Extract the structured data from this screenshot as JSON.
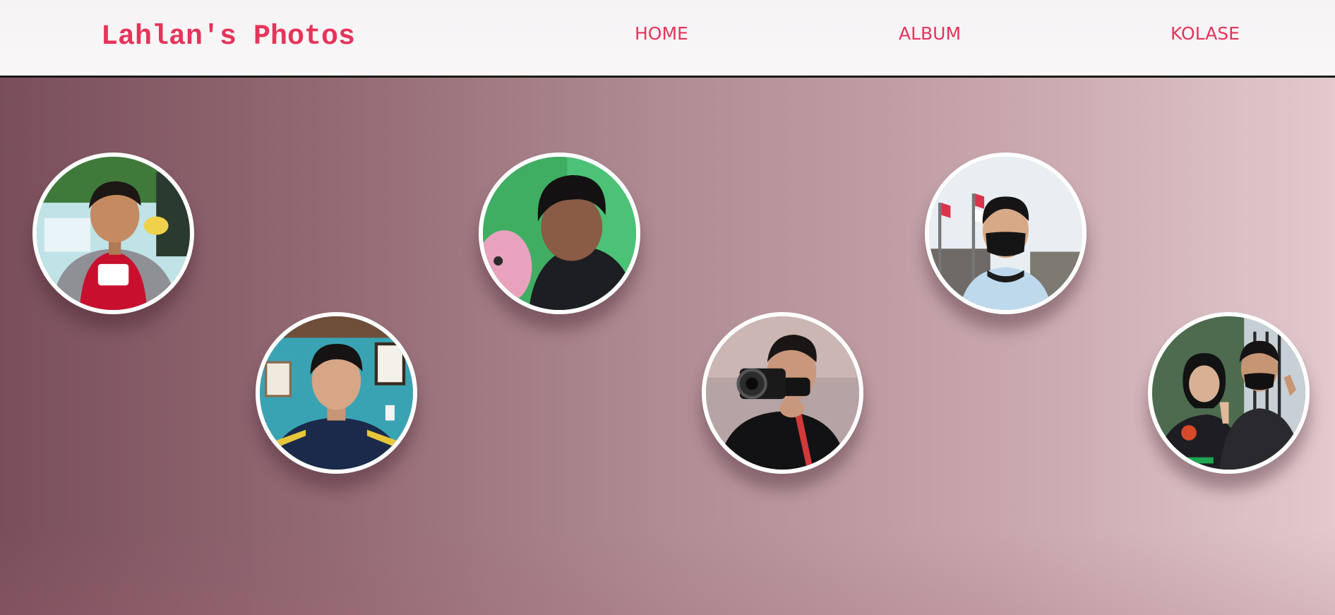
{
  "header": {
    "brand": "Lahlan's Photos",
    "nav": [
      {
        "label": "HOME"
      },
      {
        "label": "ALBUM"
      },
      {
        "label": "KOLASE"
      }
    ]
  },
  "colors": {
    "accent": "#e6345a",
    "navbar_bg": "#f7f5f6",
    "gradient_start": "#7a4f5b",
    "gradient_end": "#e2c9cd"
  },
  "gallery": {
    "photos": [
      {
        "icon": "portrait-boy-red-shirt-icon"
      },
      {
        "icon": "portrait-school-uniform-icon"
      },
      {
        "icon": "portrait-green-background-icon"
      },
      {
        "icon": "portrait-camera-icon"
      },
      {
        "icon": "portrait-black-mask-icon"
      },
      {
        "icon": "portrait-couple-icon"
      }
    ]
  }
}
